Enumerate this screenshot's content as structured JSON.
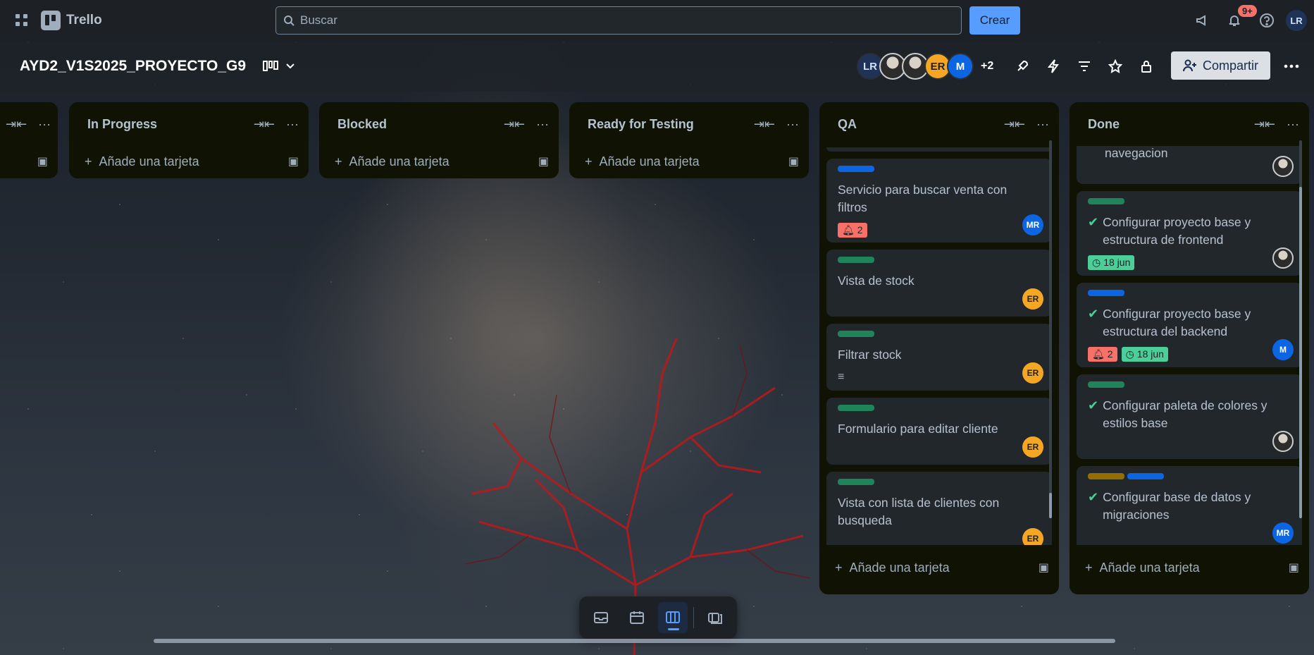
{
  "app": {
    "name": "Trello",
    "search_placeholder": "Buscar",
    "create_label": "Crear",
    "notifications_badge": "9+",
    "user_initials": "LR"
  },
  "board": {
    "title": "AYD2_V1S2025_PROYECTO_G9",
    "members": [
      {
        "initials": "LR",
        "color": "#1f3358",
        "text": "#cfe1fd"
      },
      {
        "initials": "",
        "color": "#8a94a0",
        "text": "#fff"
      },
      {
        "initials": "",
        "color": "#6b6b6b",
        "text": "#fff"
      },
      {
        "initials": "ER",
        "color": "#f5a623",
        "text": "#1d2125"
      },
      {
        "initials": "M",
        "color": "#0c66e4",
        "text": "#fff"
      }
    ],
    "more_members": "+2",
    "share_label": "Compartir"
  },
  "lists": {
    "first": {
      "title": ""
    },
    "in_progress": {
      "title": "In Progress",
      "add_card": "Añade una tarjeta"
    },
    "blocked": {
      "title": "Blocked",
      "add_card": "Añade una tarjeta"
    },
    "ready": {
      "title": "Ready for Testing",
      "add_card": "Añade una tarjeta"
    },
    "qa": {
      "title": "QA",
      "add_card": "Añade una tarjeta",
      "cards": [
        {
          "labels": [
            "#0c66e4"
          ],
          "title": "Servicio para buscar venta con filtros",
          "notif": "2",
          "avatar": "MR",
          "avatar_color": "#0c66e4"
        },
        {
          "labels": [
            "#1f845a"
          ],
          "title": "Vista de stock",
          "avatar": "ER",
          "avatar_color": "#f5a623"
        },
        {
          "labels": [
            "#1f845a"
          ],
          "title": "Filtrar stock",
          "has_description": true,
          "avatar": "ER",
          "avatar_color": "#f5a623"
        },
        {
          "labels": [
            "#1f845a"
          ],
          "title": "Formulario para editar cliente",
          "avatar": "ER",
          "avatar_color": "#f5a623"
        },
        {
          "labels": [
            "#1f845a"
          ],
          "title": "Vista con lista de clientes con busqueda",
          "avatar": "ER",
          "avatar_color": "#f5a623"
        }
      ]
    },
    "done": {
      "title": "Done",
      "add_card": "Añade una tarjeta",
      "cards": [
        {
          "labels": [],
          "title": "navegacion",
          "partial": true,
          "avatar": "photo"
        },
        {
          "labels": [
            "#1f845a"
          ],
          "title": "Configurar proyecto base y estructura de frontend",
          "done": true,
          "date": "18 jun",
          "avatar": "photo"
        },
        {
          "labels": [
            "#0c66e4"
          ],
          "title": "Configurar proyecto base y estructura del backend",
          "done": true,
          "notif": "2",
          "date": "18 jun",
          "avatar": "M",
          "avatar_color": "#0c66e4"
        },
        {
          "labels": [
            "#1f845a"
          ],
          "title": "Configurar paleta de colores y estilos base",
          "done": true,
          "avatar": "photo"
        },
        {
          "labels": [
            "#946f00",
            "#0c66e4"
          ],
          "title": "Configurar base de datos y migraciones",
          "done": true,
          "avatar": "MR",
          "avatar_color": "#0c66e4"
        }
      ]
    }
  },
  "colors": {
    "accent": "#579dff",
    "date_chip": "#4bce97",
    "notif_chip": "#f87168"
  }
}
